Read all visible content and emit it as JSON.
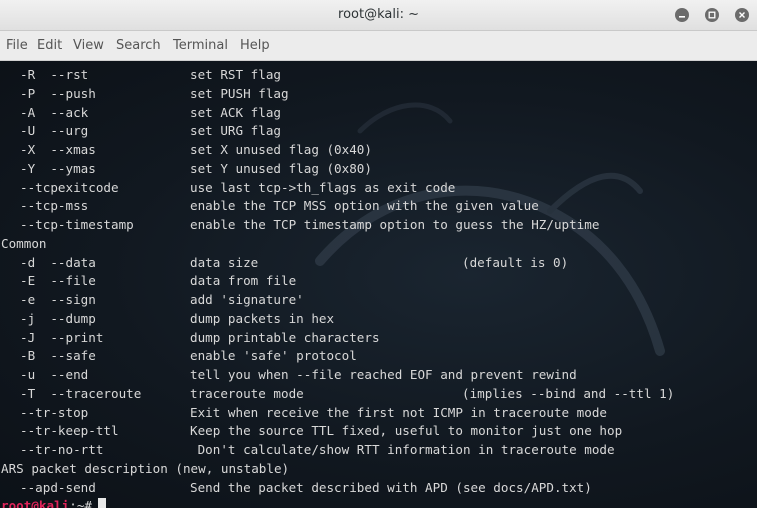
{
  "window": {
    "title": "root@kali: ~"
  },
  "menu": [
    "File",
    "Edit",
    "View",
    "Search",
    "Terminal",
    "Help"
  ],
  "terminal": {
    "lines": [
      {
        "opt": "-R  --rst",
        "desc": "set RST flag"
      },
      {
        "opt": "-P  --push",
        "desc": "set PUSH flag"
      },
      {
        "opt": "-A  --ack",
        "desc": "set ACK flag"
      },
      {
        "opt": "-U  --urg",
        "desc": "set URG flag"
      },
      {
        "opt": "-X  --xmas",
        "desc": "set X unused flag (0x40)"
      },
      {
        "opt": "-Y  --ymas",
        "desc": "set Y unused flag (0x80)"
      },
      {
        "opt": "--tcpexitcode",
        "desc": "use last tcp->th_flags as exit code"
      },
      {
        "opt": "--tcp-mss",
        "desc": "enable the TCP MSS option with the given value"
      },
      {
        "opt": "--tcp-timestamp",
        "desc": "enable the TCP timestamp option to guess the HZ/uptime"
      },
      {
        "heading": "Common"
      },
      {
        "opt": "-d  --data",
        "desc": "data size",
        "note": "(default is 0)"
      },
      {
        "opt": "-E  --file",
        "desc": "data from file"
      },
      {
        "opt": "-e  --sign",
        "desc": "add 'signature'"
      },
      {
        "opt": "-j  --dump",
        "desc": "dump packets in hex"
      },
      {
        "opt": "-J  --print",
        "desc": "dump printable characters"
      },
      {
        "opt": "-B  --safe",
        "desc": "enable 'safe' protocol"
      },
      {
        "opt": "-u  --end",
        "desc": "tell you when --file reached EOF and prevent rewind"
      },
      {
        "opt": "-T  --traceroute",
        "desc": "traceroute mode",
        "note": "(implies --bind and --ttl 1)"
      },
      {
        "opt": "--tr-stop",
        "desc": "Exit when receive the first not ICMP in traceroute mode"
      },
      {
        "opt": "--tr-keep-ttl",
        "desc": "Keep the source TTL fixed, useful to monitor just one hop"
      },
      {
        "opt": "--tr-no-rtt",
        "desc": " Don't calculate/show RTT information in traceroute mode"
      },
      {
        "heading": "ARS packet description (new, unstable)"
      },
      {
        "opt": "--apd-send",
        "desc": "Send the packet described with APD (see docs/APD.txt)"
      }
    ],
    "prompt": {
      "user_host": "root@kali",
      "path_symbol": ":~#"
    }
  },
  "colors": {
    "terminal_bg": "#10151b",
    "text": "#d8d8d8",
    "prompt": "#e0245a"
  },
  "icons": [
    "minimize-icon",
    "maximize-icon",
    "close-icon"
  ]
}
